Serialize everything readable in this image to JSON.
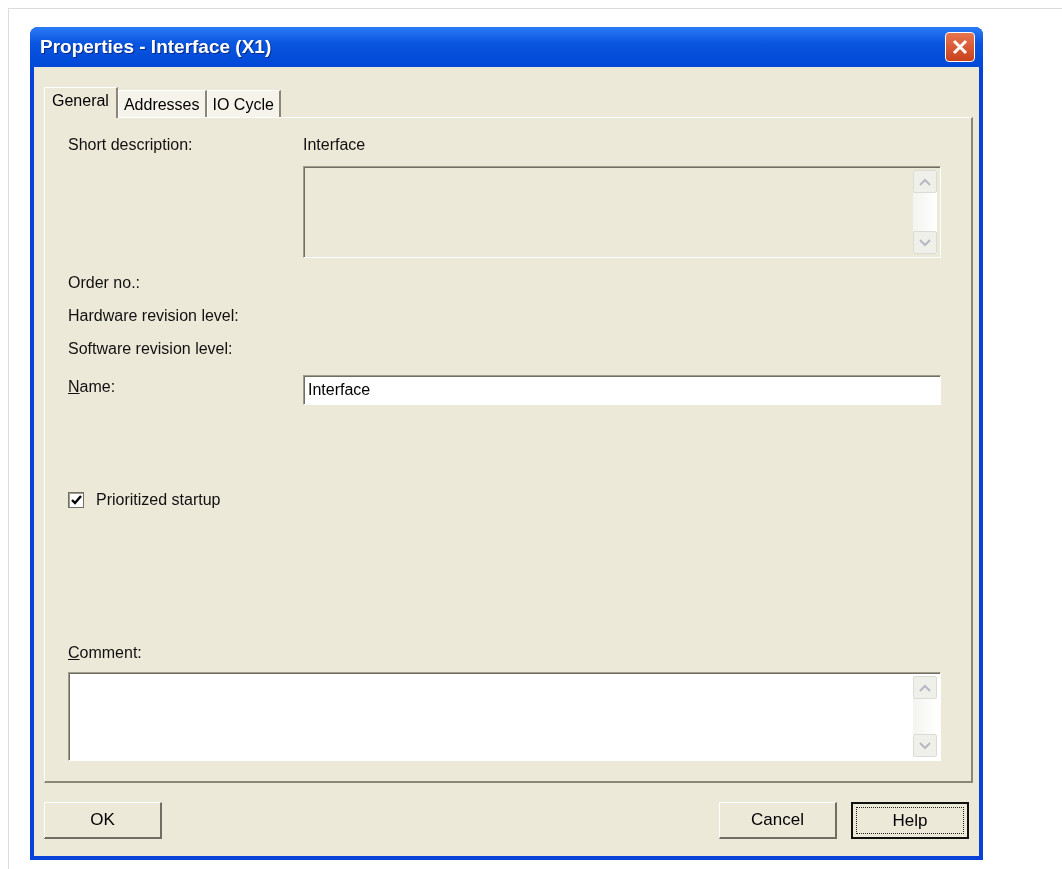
{
  "window": {
    "title": "Properties - Interface (X1)"
  },
  "tabs": [
    {
      "label": "General",
      "selected": true
    },
    {
      "label": "Addresses",
      "selected": false
    },
    {
      "label": "IO Cycle",
      "selected": false
    }
  ],
  "short_description": {
    "label": "Short description:",
    "value": "Interface",
    "text_area_disabled": true
  },
  "info_rows": [
    {
      "label": "Order no.:"
    },
    {
      "label": "Hardware revision level:"
    },
    {
      "label": "Software revision level:"
    }
  ],
  "name_field": {
    "label": "Name:",
    "mnemonic_underlined": true,
    "value": "Interface"
  },
  "prioritized_startup": {
    "label": "Prioritized startup",
    "checked": true
  },
  "comment": {
    "label": "Comment:",
    "mnemonic_underlined": true
  },
  "buttons": [
    {
      "label": "OK",
      "focused": false
    },
    {
      "label": "Cancel",
      "focused": false
    },
    {
      "label": "Help",
      "focused": true
    }
  ]
}
